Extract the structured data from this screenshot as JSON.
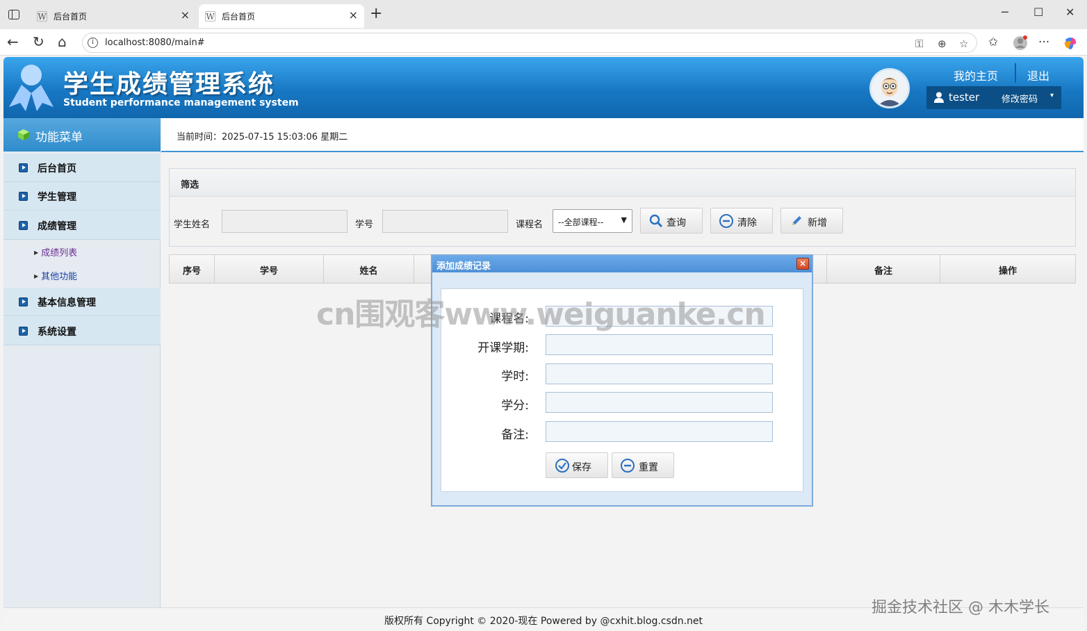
{
  "browser": {
    "tabs": [
      {
        "favicon": "W",
        "title": "后台首页",
        "close": "×"
      },
      {
        "favicon": "W",
        "title": "后台首页",
        "close": "×"
      }
    ],
    "new_tab": "+",
    "url": "localhost:8080/main#"
  },
  "header": {
    "title": "学生成绩管理系统",
    "subtitle": "Student performance management system",
    "my_home": "我的主页",
    "logout": "退出",
    "username": "tester",
    "change_password": "修改密码"
  },
  "sidebar": {
    "heading": "功能菜单",
    "items": [
      {
        "label": "后台首页"
      },
      {
        "label": "学生管理"
      },
      {
        "label": "成绩管理"
      },
      {
        "label": "基本信息管理"
      },
      {
        "label": "系统设置"
      }
    ],
    "subitems": [
      {
        "label": "成绩列表"
      },
      {
        "label": "其他功能"
      }
    ]
  },
  "timebar": {
    "text": "当前时间：2025-07-15 15:03:06 星期二"
  },
  "filter": {
    "heading": "筛选",
    "student_name_label": "学生姓名",
    "student_no_label": "学号",
    "course_label": "课程名",
    "course_selected": "--全部课程--",
    "search_label": "查询",
    "clear_label": "清除",
    "add_label": "新增"
  },
  "grid": {
    "columns": [
      "序号",
      "学号",
      "姓名",
      "备注",
      "操作"
    ]
  },
  "dialog": {
    "title": "添加成绩记录",
    "fields": [
      {
        "label": "课程名:",
        "value": ""
      },
      {
        "label": "开课学期:",
        "value": ""
      },
      {
        "label": "学时:",
        "value": ""
      },
      {
        "label": "学分:",
        "value": ""
      },
      {
        "label": "备注:",
        "value": ""
      }
    ],
    "save_label": "保存",
    "reset_label": "重置"
  },
  "footer": {
    "text": "版权所有 Copyright © 2020-现在 Powered by @cxhit.blog.csdn.net"
  },
  "watermarks": {
    "center": "cn围观客www.weiguanke.cn",
    "corner": "掘金技术社区 @ 木木学长"
  },
  "colors": {
    "header_blue": "#1878c4",
    "menu_blue": "#2f8ccc",
    "accent_line": "#3c94d6"
  }
}
